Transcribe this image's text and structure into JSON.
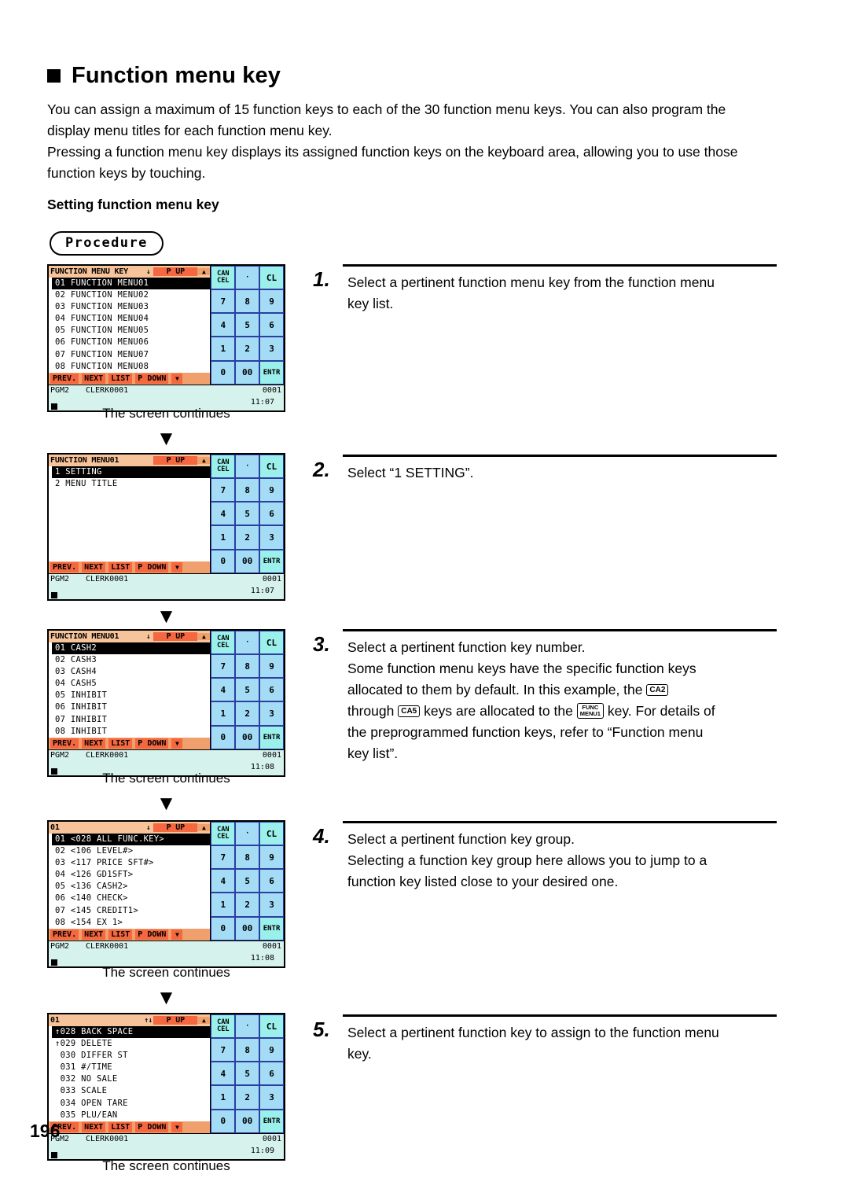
{
  "heading": {
    "bullet": "square-bullet",
    "title": "Function menu key"
  },
  "intro": {
    "paragraph1": "You can assign a maximum of 15 function keys to each of the 30 function menu keys. You can also program the display menu titles for each function menu key.",
    "paragraph2": "Pressing a function menu key displays its assigned function keys on the keyboard area, allowing you to use those function keys by touching.",
    "subheading": "Setting function menu key",
    "procedure_badge": "Procedure"
  },
  "page_number": "196",
  "continues_caption": "The screen continues",
  "keypad": {
    "cancel_line1": "CAN",
    "cancel_line2": "CEL",
    "dot": "·",
    "cl": "CL",
    "k7": "7",
    "k8": "8",
    "k9": "9",
    "k4": "4",
    "k5": "5",
    "k6": "6",
    "k1": "1",
    "k2": "2",
    "k3": "3",
    "k0": "0",
    "k00": "00",
    "entr": "ENTR"
  },
  "function_bar": {
    "prev": "PREV.",
    "next": "NEXT",
    "list": "LIST",
    "p_down": "P DOWN",
    "down_arrow": "▼"
  },
  "title_bar": {
    "p_up": "P UP",
    "up_arrow": "▲"
  },
  "screens": [
    {
      "id": "screen-1",
      "title": "FUNCTION MENU KEY",
      "title_arrow": "↓",
      "items": [
        "01 FUNCTION MENU01",
        "02 FUNCTION MENU02",
        "03 FUNCTION MENU03",
        "04 FUNCTION MENU04",
        "05 FUNCTION MENU05",
        "06 FUNCTION MENU06",
        "07 FUNCTION MENU07",
        "08 FUNCTION MENU08"
      ],
      "selected_index": 0,
      "status": {
        "mode": "PGM2",
        "clerk": "CLERK0001",
        "number": "0001",
        "time": "11:07"
      }
    },
    {
      "id": "screen-2",
      "title": "FUNCTION MENU01",
      "title_arrow": "",
      "items": [
        "1 SETTING",
        "2 MENU TITLE"
      ],
      "selected_index": 0,
      "status": {
        "mode": "PGM2",
        "clerk": "CLERK0001",
        "number": "0001",
        "time": "11:07"
      }
    },
    {
      "id": "screen-3",
      "title": "FUNCTION MENU01",
      "title_arrow": "↓",
      "items": [
        "01 CASH2",
        "02 CASH3",
        "03 CASH4",
        "04 CASH5",
        "05 INHIBIT",
        "06 INHIBIT",
        "07 INHIBIT",
        "08 INHIBIT"
      ],
      "selected_index": 0,
      "status": {
        "mode": "PGM2",
        "clerk": "CLERK0001",
        "number": "0001",
        "time": "11:08"
      }
    },
    {
      "id": "screen-4",
      "title": "01",
      "title_arrow": "↓",
      "items": [
        "01 <028 ALL FUNC.KEY>",
        "02 <106 LEVEL#>",
        "03 <117 PRICE SFT#>",
        "04 <126 GD1SFT>",
        "05 <136 CASH2>",
        "06 <140 CHECK>",
        "07 <145 CREDIT1>",
        "08 <154 EX 1>"
      ],
      "selected_index": 0,
      "status": {
        "mode": "PGM2",
        "clerk": "CLERK0001",
        "number": "0001",
        "time": "11:08"
      }
    },
    {
      "id": "screen-5",
      "title": "01",
      "title_arrow": "↑↓",
      "items": [
        "↑028 BACK SPACE",
        "↑029 DELETE",
        " 030 DIFFER ST",
        " 031 #/TIME",
        " 032 NO SALE",
        " 033 SCALE",
        " 034 OPEN TARE",
        " 035 PLU/EAN"
      ],
      "selected_index": 0,
      "status": {
        "mode": "PGM2",
        "clerk": "CLERK0001",
        "number": "0001",
        "time": "11:09"
      }
    }
  ],
  "steps": [
    {
      "number": "1.",
      "line1": "Select a pertinent function menu key from the function menu",
      "line2": "key list."
    },
    {
      "number": "2.",
      "line1": "Select “1 SETTING”.",
      "line2": ""
    },
    {
      "number": "3.",
      "line1": "Select a pertinent function key number.",
      "p_a": "Some function menu keys have the specific function keys",
      "p_b": "allocated to them by default. In this example, the",
      "key_ca2": "CA2",
      "p_c": "through",
      "key_ca5": "CA5",
      "p_d": "keys are allocated to the",
      "key_func_line1": "FUNC",
      "key_func_line2": "MENU1",
      "p_e": "key. For details of",
      "p_f": "the preprogrammed function keys, refer to “Function menu",
      "p_g": "key list”."
    },
    {
      "number": "4.",
      "line1": "Select a pertinent function key group.",
      "line2": "Selecting a function key group here allows you to jump to a",
      "line3": "function key listed close to your desired one."
    },
    {
      "number": "5.",
      "line1": "Select a pertinent function key to assign to the function menu",
      "line2": "key."
    }
  ],
  "colors": {
    "title_bar": "#f6c39a",
    "p_up_key": "#f4673f",
    "fn_bar": "#f0a06d",
    "status_bar": "#d6f2ec",
    "key_blue": "#a5dcf5",
    "key_cyan": "#9bf0ec",
    "key_border": "#2b3fa0"
  }
}
